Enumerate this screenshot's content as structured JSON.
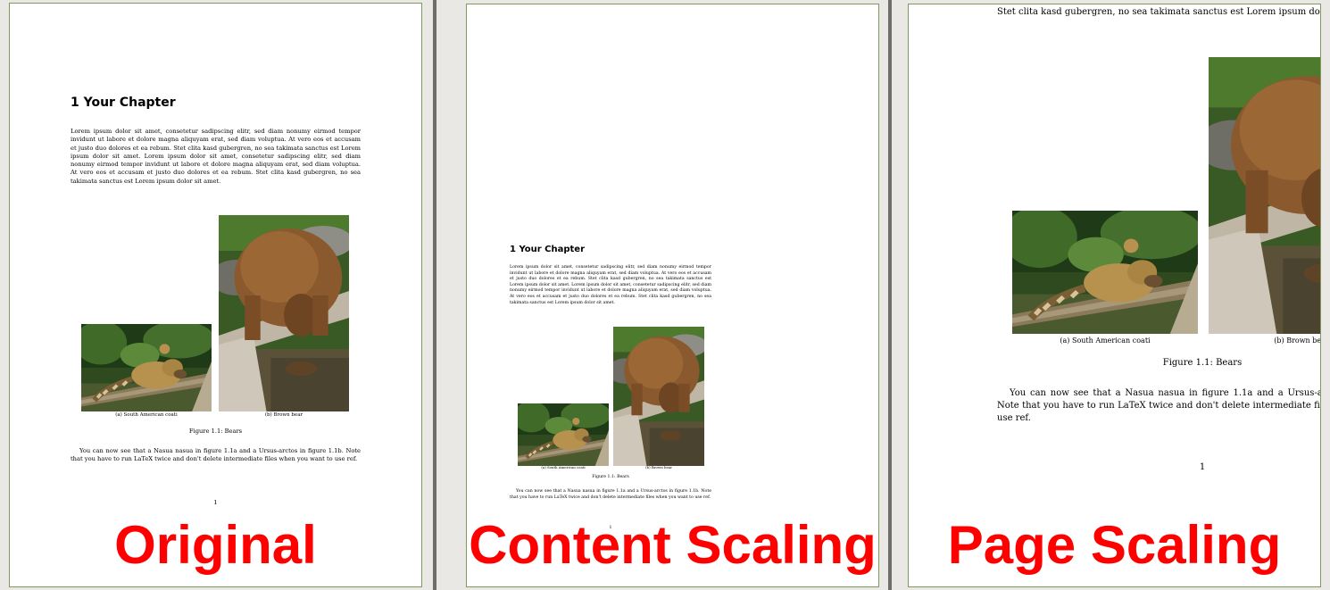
{
  "labels": {
    "original": "Original",
    "content_scaling": "Content Scaling",
    "page_scaling": "Page Scaling"
  },
  "document": {
    "chapter_title": "1  Your Chapter",
    "paragraph_full": "Lorem ipsum dolor sit amet, consetetur sadipscing elitr, sed diam nonumy eirmod tempor invidunt ut labore et dolore magna aliquyam erat, sed diam voluptua. At vero eos et accusam et justo duo dolores et ea rebum. Stet clita kasd gubergren, no sea takimata sanctus est Lorem ipsum dolor sit amet. Lorem ipsum dolor sit amet, consetetur sadipscing elitr, sed diam nonumy eirmod tempor invidunt ut labore et dolore magna aliquyam erat, sed diam voluptua. At vero eos et accusam et justo duo dolores et ea rebum. Stet clita kasd gubergren, no sea takimata sanctus est Lorem ipsum dolor sit amet.",
    "paragraph_tail": "aliquyam erat, sed diam voluptua. At vero eos et accusam et justo duo dolores et ea rebum. Stet clita kasd gubergren, no sea takimata sanctus est Lorem ipsum dolor sit amet.",
    "subcaption_a": "(a) South American coati",
    "subcaption_b": "(b) Brown bear",
    "figure_caption": "Figure 1.1: Bears",
    "after_text": "You can now see that a Nasua nasua in figure 1.1a and a Ursus-arctos in figure 1.1b. Note that you have to run LaTeX twice and don't delete intermediate files when you want to use ref.",
    "page_number": "1"
  },
  "colors": {
    "label_red": "#ff0000",
    "page_border": "#7f9a5a",
    "separator": "#6d6d6d",
    "background": "#e9e8e5"
  },
  "icons": [
    "coati-photo",
    "bear-photo"
  ]
}
